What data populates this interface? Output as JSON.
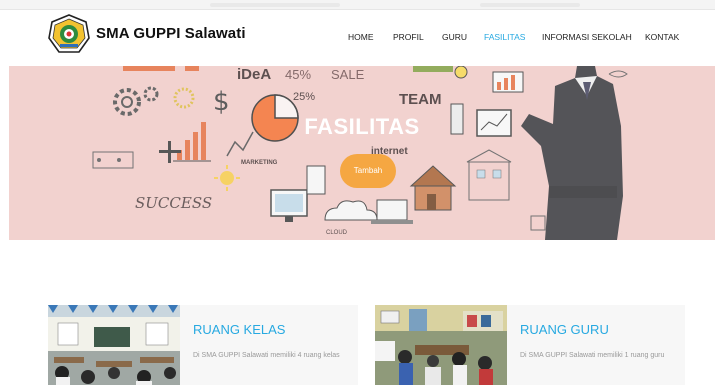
{
  "brand": {
    "name": "SMA GUPPI Salawati",
    "logo_icon": "school-emblem-icon"
  },
  "nav": {
    "items": [
      {
        "label": "HOME",
        "active": false
      },
      {
        "label": "PROFIL",
        "active": false
      },
      {
        "label": "GURU",
        "active": false
      },
      {
        "label": "FASILITAS",
        "active": true
      },
      {
        "label": "INFORMASI SEKOLAH",
        "active": false
      },
      {
        "label": "KONTAK",
        "active": false
      }
    ]
  },
  "hero": {
    "title": "FASILITAS",
    "button_label": "Tambah",
    "doodle_words": [
      "iDeA",
      "45%",
      "SALE",
      "25%",
      "TEAM",
      "MARKETING",
      "SUCCESS",
      "internet",
      "CLOUD"
    ]
  },
  "cards": [
    {
      "title": "RUANG KELAS",
      "description": "Di SMA GUPPI Salawati memiliki 4 ruang kelas"
    },
    {
      "title": "RUANG GURU",
      "description": "Di SMA GUPPI Salawati memiliki 1 ruang guru"
    }
  ],
  "colors": {
    "accent": "#27a9e1",
    "button": "#f5a742",
    "hero_overlay": "#efc8c5"
  }
}
